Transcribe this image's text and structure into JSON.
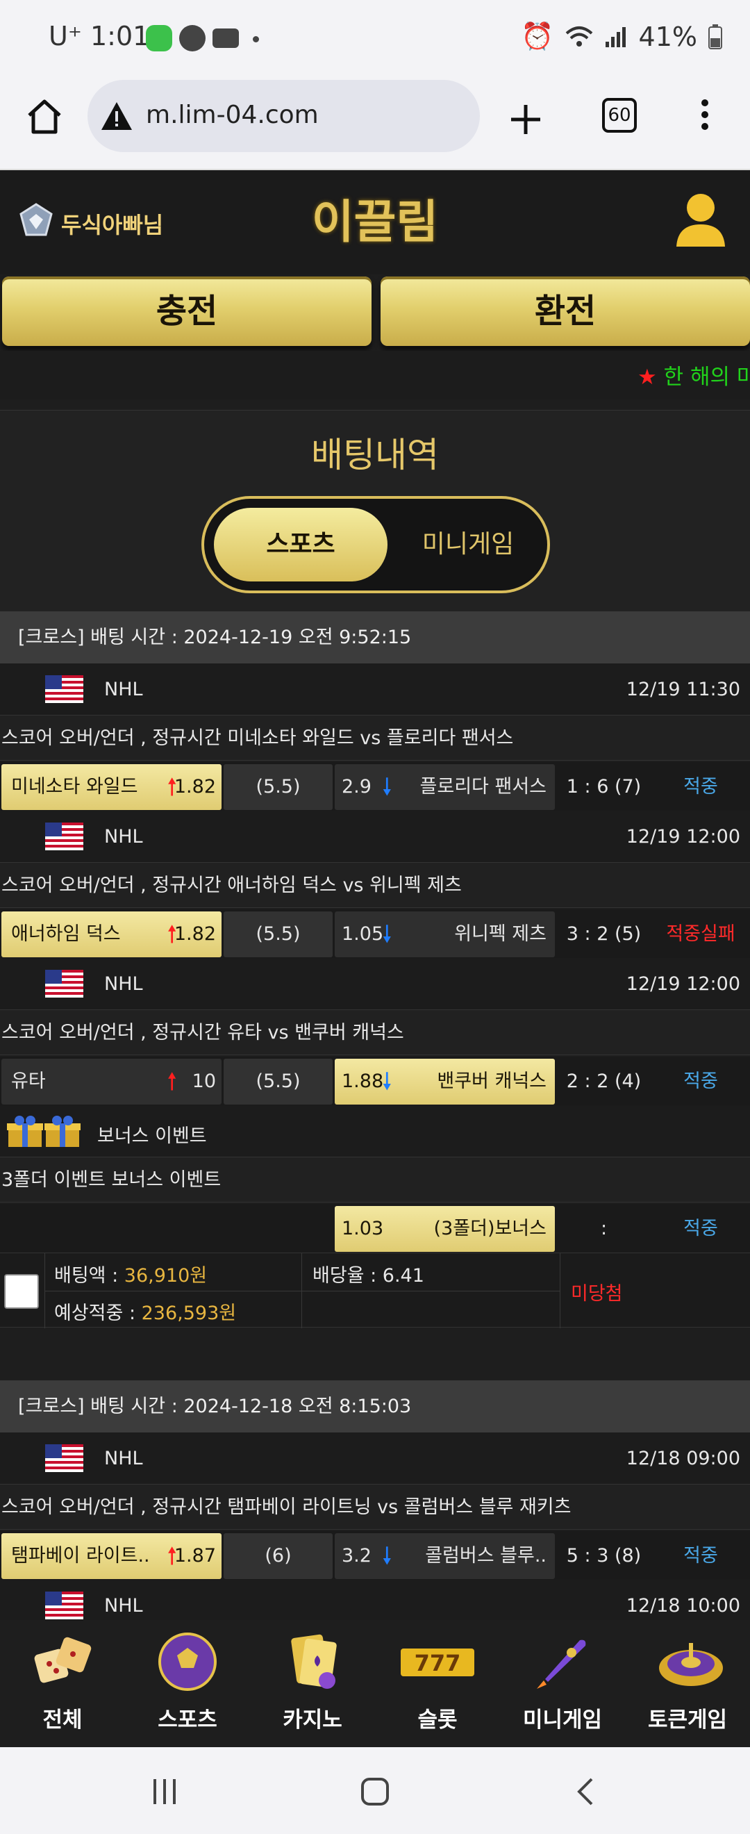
{
  "statusbar": {
    "time": "1:01",
    "carrier": "U⁺",
    "battery": "41%"
  },
  "browser": {
    "url": "m.lim-04.com",
    "tab_count": "60"
  },
  "header": {
    "username": "두식아빠님",
    "logo_text": "이끌림"
  },
  "actions": {
    "deposit": "충전",
    "withdraw": "환전"
  },
  "marquee": {
    "star": "★",
    "text": " 한 해의 마"
  },
  "page": {
    "title": "배팅내역"
  },
  "tabs": {
    "sports": "스포츠",
    "minigame": "미니게임"
  },
  "bet1": {
    "header": "[크로스] 배팅 시간 : 2024-12-19 오전 9:52:15",
    "games": [
      {
        "league": "NHL",
        "datetime": "12/19 11:30",
        "match": "스코어 오버/언더 , 정규시간 미네소타 와일드  vs  플로리다 팬서스",
        "home": "미네소타 와일드",
        "home_odds": "1.82",
        "hcp": "(5.5)",
        "away_odds": "2.9",
        "away": "플로리다 팬서스",
        "score": "1 : 6 (7)",
        "result": "적중"
      },
      {
        "league": "NHL",
        "datetime": "12/19 12:00",
        "match": "스코어 오버/언더 , 정규시간 애너하임 덕스  vs  위니펙 제츠",
        "home": "애너하임 덕스",
        "home_odds": "1.82",
        "hcp": "(5.5)",
        "away_odds": "1.05",
        "away": "위니펙 제츠",
        "score": "3 : 2 (5)",
        "result": "적중실패"
      },
      {
        "league": "NHL",
        "datetime": "12/19 12:00",
        "match": "스코어 오버/언더 , 정규시간 유타  vs  밴쿠버 캐넉스",
        "home": "유타",
        "home_odds": "10",
        "hcp": "(5.5)",
        "away_odds": "1.88",
        "away": "밴쿠버 캐넉스",
        "score": "2 : 2 (4)",
        "result": "적중"
      }
    ],
    "bonus": {
      "title": "보너스 이벤트",
      "match": "3폴더 이벤트 보너스 이벤트",
      "odds": "1.03",
      "name": "(3폴더)보너스",
      "score": ":",
      "result": "적중"
    },
    "summary": {
      "bet_amount_label": "배팅액 : ",
      "bet_amount": "36,910원",
      "rate_label": "배당율 : ",
      "rate": "6.41",
      "expected_label": "예상적중 : ",
      "expected": "236,593원",
      "status": "미당첨"
    }
  },
  "bet2": {
    "header": "[크로스] 배팅 시간 : 2024-12-18 오전 8:15:03",
    "games": [
      {
        "league": "NHL",
        "datetime": "12/18 09:00",
        "match": "스코어 오버/언더 , 정규시간 탬파베이 라이트닝  vs  콜럼버스 블루 재키츠",
        "home": "탬파베이 라이트..",
        "home_odds": "1.87",
        "hcp": "(6)",
        "away_odds": "3.2",
        "away": "콜럼버스 블루..",
        "score": "5 : 3 (8)",
        "result": "적중"
      },
      {
        "league": "NHL",
        "datetime": "12/18 10:00"
      }
    ]
  },
  "nav": {
    "all": "전체",
    "sports": "스포츠",
    "casino": "카지노",
    "slot": "슬롯",
    "minigame": "미니게임",
    "token": "토큰게임"
  },
  "colors": {
    "gold": "#e0c86a",
    "win": "#4aa8e8",
    "lose": "#ff2a2a",
    "amount": "#e8b640",
    "marquee": "#21d21b"
  }
}
